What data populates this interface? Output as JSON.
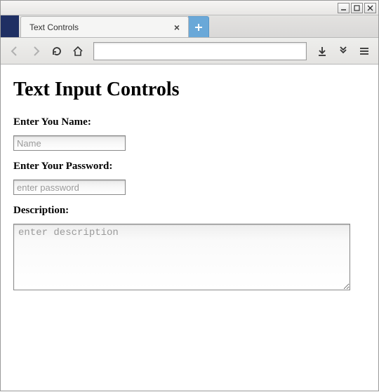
{
  "window": {
    "tab_title": "Text Controls"
  },
  "page": {
    "heading": "Text Input Controls",
    "name_label": "Enter You Name:",
    "name_placeholder": "Name",
    "password_label": "Enter Your Password:",
    "password_placeholder": "enter password",
    "description_label": "Description:",
    "description_placeholder": "enter description"
  }
}
